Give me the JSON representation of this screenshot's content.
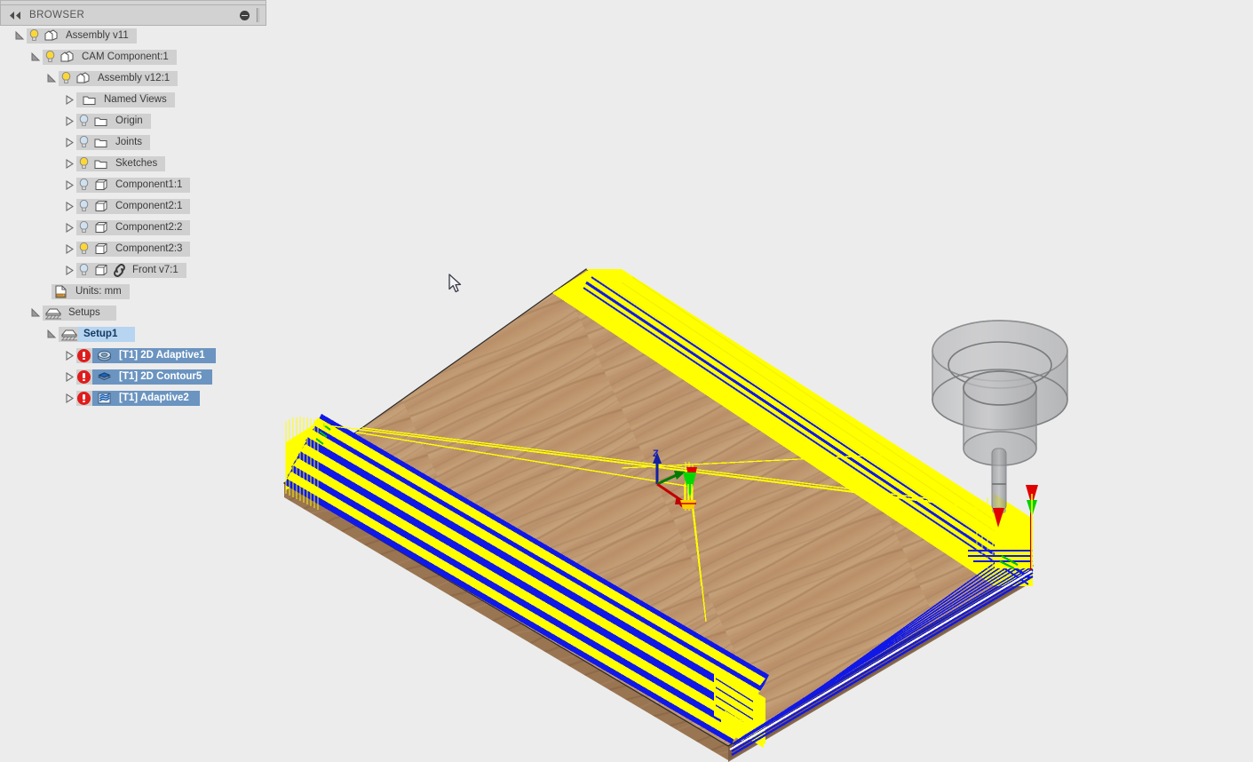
{
  "app": {
    "background_color": "#ececec",
    "panel_color": "#d2d2d2",
    "selection_color": "#6b94c0",
    "setup_selection_color": "#b7d4f0",
    "error_color": "#e01b1b"
  },
  "browser": {
    "title": "BROWSER",
    "collapse_icon": "collapse-left-arrows-icon",
    "minimize_icon": "circle-minus-icon",
    "resize_grip": "panel-resize-grip"
  },
  "tree": {
    "items": [
      {
        "id": "assembly-v11",
        "label": "Assembly v11",
        "indent": 0,
        "twist": "expanded",
        "bulb": "on",
        "icon": "component-icon",
        "state": "normal"
      },
      {
        "id": "cam-component",
        "label": "CAM Component:1",
        "indent": 1,
        "twist": "expanded",
        "bulb": "on",
        "icon": "component-icon",
        "state": "normal"
      },
      {
        "id": "assembly-v12",
        "label": "Assembly v12:1",
        "indent": 2,
        "twist": "expanded",
        "bulb": "on",
        "icon": "component-icon",
        "state": "normal"
      },
      {
        "id": "named-views",
        "label": "Named Views",
        "indent": 3,
        "twist": "collapsed",
        "bulb": "none",
        "icon": "folder-icon",
        "state": "normal"
      },
      {
        "id": "origin",
        "label": "Origin",
        "indent": 3,
        "twist": "collapsed",
        "bulb": "off",
        "icon": "folder-icon",
        "state": "normal"
      },
      {
        "id": "joints",
        "label": "Joints",
        "indent": 3,
        "twist": "collapsed",
        "bulb": "off",
        "icon": "folder-icon",
        "state": "normal"
      },
      {
        "id": "sketches",
        "label": "Sketches",
        "indent": 3,
        "twist": "collapsed",
        "bulb": "on",
        "icon": "folder-icon",
        "state": "normal"
      },
      {
        "id": "component1-1",
        "label": "Component1:1",
        "indent": 3,
        "twist": "collapsed",
        "bulb": "off",
        "icon": "body-icon",
        "state": "normal"
      },
      {
        "id": "component2-1",
        "label": "Component2:1",
        "indent": 3,
        "twist": "collapsed",
        "bulb": "off",
        "icon": "body-icon",
        "state": "normal"
      },
      {
        "id": "component2-2",
        "label": "Component2:2",
        "indent": 3,
        "twist": "collapsed",
        "bulb": "off",
        "icon": "body-icon",
        "state": "normal"
      },
      {
        "id": "component2-3",
        "label": "Component2:3",
        "indent": 3,
        "twist": "collapsed",
        "bulb": "on",
        "icon": "body-icon",
        "state": "normal"
      },
      {
        "id": "front-v7",
        "label": "Front v7:1",
        "indent": 3,
        "twist": "collapsed",
        "bulb": "off",
        "icon": "body-link-icon",
        "state": "normal"
      },
      {
        "id": "units",
        "label": "Units: mm",
        "indent": 2,
        "twist": "none",
        "bulb": "none",
        "icon": "units-doc-icon",
        "state": "normal"
      },
      {
        "id": "setups",
        "label": "Setups",
        "indent": 1,
        "twist": "expanded",
        "bulb": "none",
        "icon": "setup-vise-icon",
        "state": "normal"
      },
      {
        "id": "setup1",
        "label": "Setup1",
        "indent": 2,
        "twist": "expanded",
        "bulb": "none",
        "icon": "setup-vise-icon",
        "state": "setup-selected"
      }
    ],
    "operations": [
      {
        "id": "op-2d-adaptive1",
        "label": "[T1] 2D Adaptive1",
        "icon": "adaptive-2d-icon",
        "error": true,
        "selected": true,
        "twist": "collapsed"
      },
      {
        "id": "op-2d-contour5",
        "label": "[T1] 2D Contour5",
        "icon": "contour-2d-icon",
        "error": true,
        "selected": true,
        "twist": "collapsed"
      },
      {
        "id": "op-adaptive2",
        "label": "[T1] Adaptive2",
        "icon": "adaptive-3d-icon",
        "error": true,
        "selected": true,
        "twist": "collapsed"
      }
    ]
  },
  "viewport": {
    "name": "cam-3d-viewport",
    "stock_material": "wood",
    "origin_axis_label_z": "Z",
    "toolpath_colors": {
      "rapid": "#ffff00",
      "cutting": "#1018e8",
      "lead": "#00c000",
      "plunge": "#d00000"
    },
    "tool_assembly": "tool-holder-assembly",
    "cursor": "arrow-cursor"
  }
}
